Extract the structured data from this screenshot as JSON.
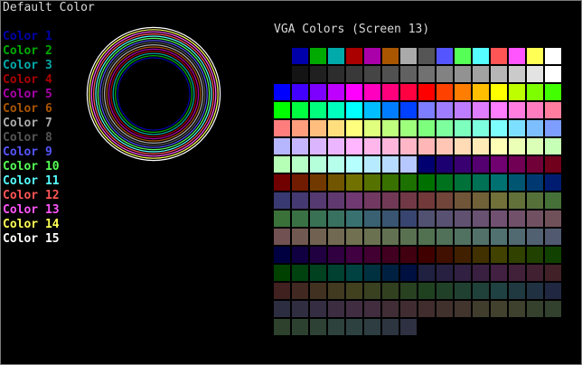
{
  "window": {
    "title": "Default Color"
  },
  "legend": {
    "items": [
      {
        "label": "Color 1",
        "color": "#0000AA"
      },
      {
        "label": "Color 2",
        "color": "#00AA00"
      },
      {
        "label": "Color 3",
        "color": "#00AAAA"
      },
      {
        "label": "Color 4",
        "color": "#AA0000"
      },
      {
        "label": "Color 5",
        "color": "#AA00AA"
      },
      {
        "label": "Color 6",
        "color": "#AA5500"
      },
      {
        "label": "Color 7",
        "color": "#AAAAAA"
      },
      {
        "label": "Color 8",
        "color": "#555555"
      },
      {
        "label": "Color 9",
        "color": "#5555FF"
      },
      {
        "label": "Color 10",
        "color": "#55FF55"
      },
      {
        "label": "Color 11",
        "color": "#55FFFF"
      },
      {
        "label": "Color 12",
        "color": "#FF5555"
      },
      {
        "label": "Color 13",
        "color": "#FF55FF"
      },
      {
        "label": "Color 14",
        "color": "#FFFF55"
      },
      {
        "label": "Color 15",
        "color": "#FFFFFF"
      }
    ]
  },
  "vga": {
    "title": "VGA Colors (Screen 13)",
    "swatch_count": 256
  }
}
